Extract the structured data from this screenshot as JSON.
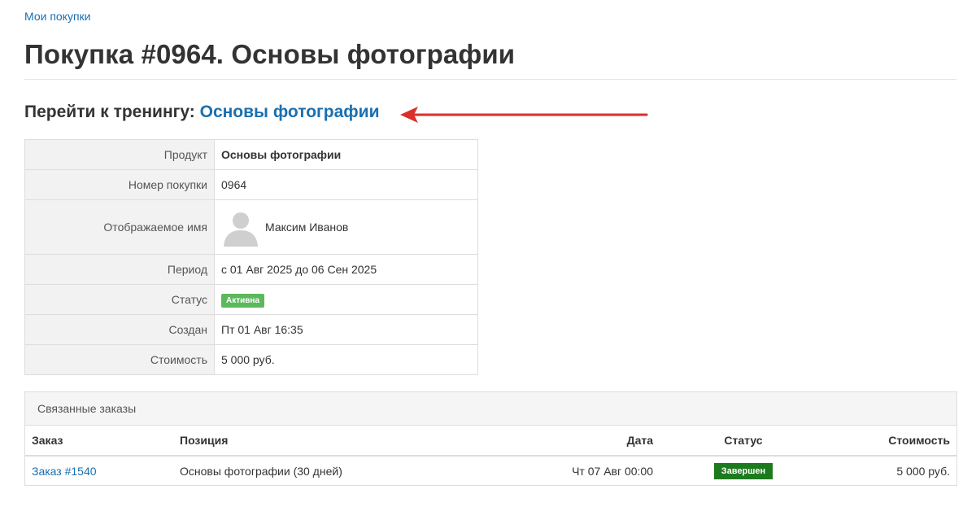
{
  "breadcrumb": "Мои покупки",
  "page_title": "Покупка #0964. Основы фотографии",
  "training": {
    "prefix": "Перейти к тренингу: ",
    "link_text": "Основы фотографии"
  },
  "annotation_arrow_color": "#d9302c",
  "details": {
    "product_label": "Продукт",
    "product_value": "Основы фотографии",
    "purchase_number_label": "Номер покупки",
    "purchase_number_value": "0964",
    "display_name_label": "Отображаемое имя",
    "display_name_value": "Максим Иванов",
    "period_label": "Период",
    "period_value": "с 01 Авг 2025 до 06 Сен 2025",
    "status_label": "Статус",
    "status_value": "Активна",
    "created_label": "Создан",
    "created_value": "Пт 01 Авг 16:35",
    "cost_label": "Стоимость",
    "cost_value": "5 000 руб."
  },
  "related_orders": {
    "title": "Связанные заказы",
    "columns": {
      "order": "Заказ",
      "item": "Позиция",
      "date": "Дата",
      "status": "Статус",
      "cost": "Стоимость"
    },
    "rows": [
      {
        "order": "Заказ #1540",
        "item": "Основы фотографии (30 дней)",
        "date": "Чт 07 Авг 00:00",
        "status": "Завершен",
        "cost": "5 000 руб."
      }
    ]
  },
  "colors": {
    "link": "#1a6fb0",
    "active_badge": "#5cb85c",
    "completed_badge": "#1e7a1e"
  }
}
